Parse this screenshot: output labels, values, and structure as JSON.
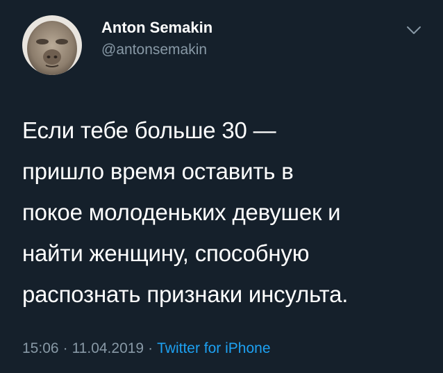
{
  "tweet": {
    "author_name": "Anton Semakin",
    "author_handle": "@antonsemakin",
    "text": "Если тебе больше 30 —\nпришло время оставить в\nпокое молоденьких девушек и\nнайти женщину, способную\nраспознать признаки инсульта.",
    "time": "15:06",
    "date": "11.04.2019",
    "separator": "·",
    "source": "Twitter for iPhone"
  },
  "icons": {
    "menu": "chevron-down-icon"
  },
  "colors": {
    "background": "#15202b",
    "primary_text": "#ffffff",
    "secondary_text": "#8899a6",
    "link": "#1da1f2"
  }
}
